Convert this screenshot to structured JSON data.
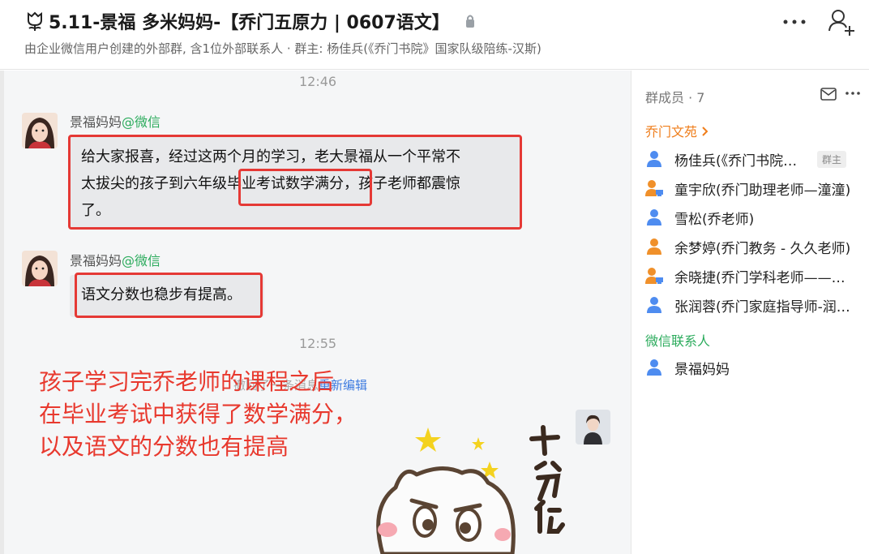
{
  "header": {
    "title": "5.11-景福 多米妈妈-【乔门五原力 | 0607语文】",
    "subtitle": "由企业微信用户创建的外部群, 含1位外部联系人 · 群主: 杨佳兵(《乔门书院》国家队级陪练-汉斯)",
    "icons": [
      "tulip-icon",
      "lock-icon",
      "more-icon",
      "add-member-icon"
    ]
  },
  "chat": {
    "time1": "12:46",
    "messages": [
      {
        "sender": "景福妈妈",
        "source": "@微信",
        "lines": [
          "给大家报喜，经过这两个月的学习，老大景福从一个平常不",
          "太拔尖的孩子到六年级毕业考试数学满分，孩子老师都震惊",
          "了。"
        ]
      },
      {
        "sender": "景福妈妈",
        "source": "@微信",
        "lines": [
          "语文分数也稳步有提高。"
        ]
      }
    ],
    "time2": "12:55",
    "recall_text": "撤回了一条消息",
    "recall_action": "重新编辑",
    "annotation": [
      "孩子学习完乔老师的课程之后",
      "在毕业考试中获得了数学满分，",
      "以及语文的分数也有提高"
    ],
    "sticker_text": "十分优秀"
  },
  "sidebar": {
    "member_count": "群成员 · 7",
    "section_qiao": "乔门文苑",
    "section_wechat": "微信联系人",
    "owner_badge": "群主",
    "members": [
      {
        "name": "杨佳兵(《乔门书院》国家队级陪练-汉斯)",
        "icon": "blue-person-icon"
      },
      {
        "name": "童宇欣(乔门助理老师—潼潼)",
        "icon": "orange-person-computer-icon"
      },
      {
        "name": "雪松(乔老师)",
        "icon": "blue-person-icon"
      },
      {
        "name": "余梦婷(乔门教务 - 久久老师)",
        "icon": "orange-person-icon"
      },
      {
        "name": "余晓捷(乔门学科老师——小捷)",
        "icon": "orange-person-computer-icon"
      },
      {
        "name": "张润蓉(乔门家庭指导师-润蓉)",
        "icon": "blue-person-icon"
      }
    ],
    "wechat_members": [
      {
        "name": "景福妈妈",
        "icon": "blue-person-icon"
      }
    ],
    "colors": {
      "qiao": "#ef7d1a",
      "wechat": "#2bab5c",
      "person_blue": "#4e8cf0",
      "person_orange": "#f0902a"
    }
  }
}
